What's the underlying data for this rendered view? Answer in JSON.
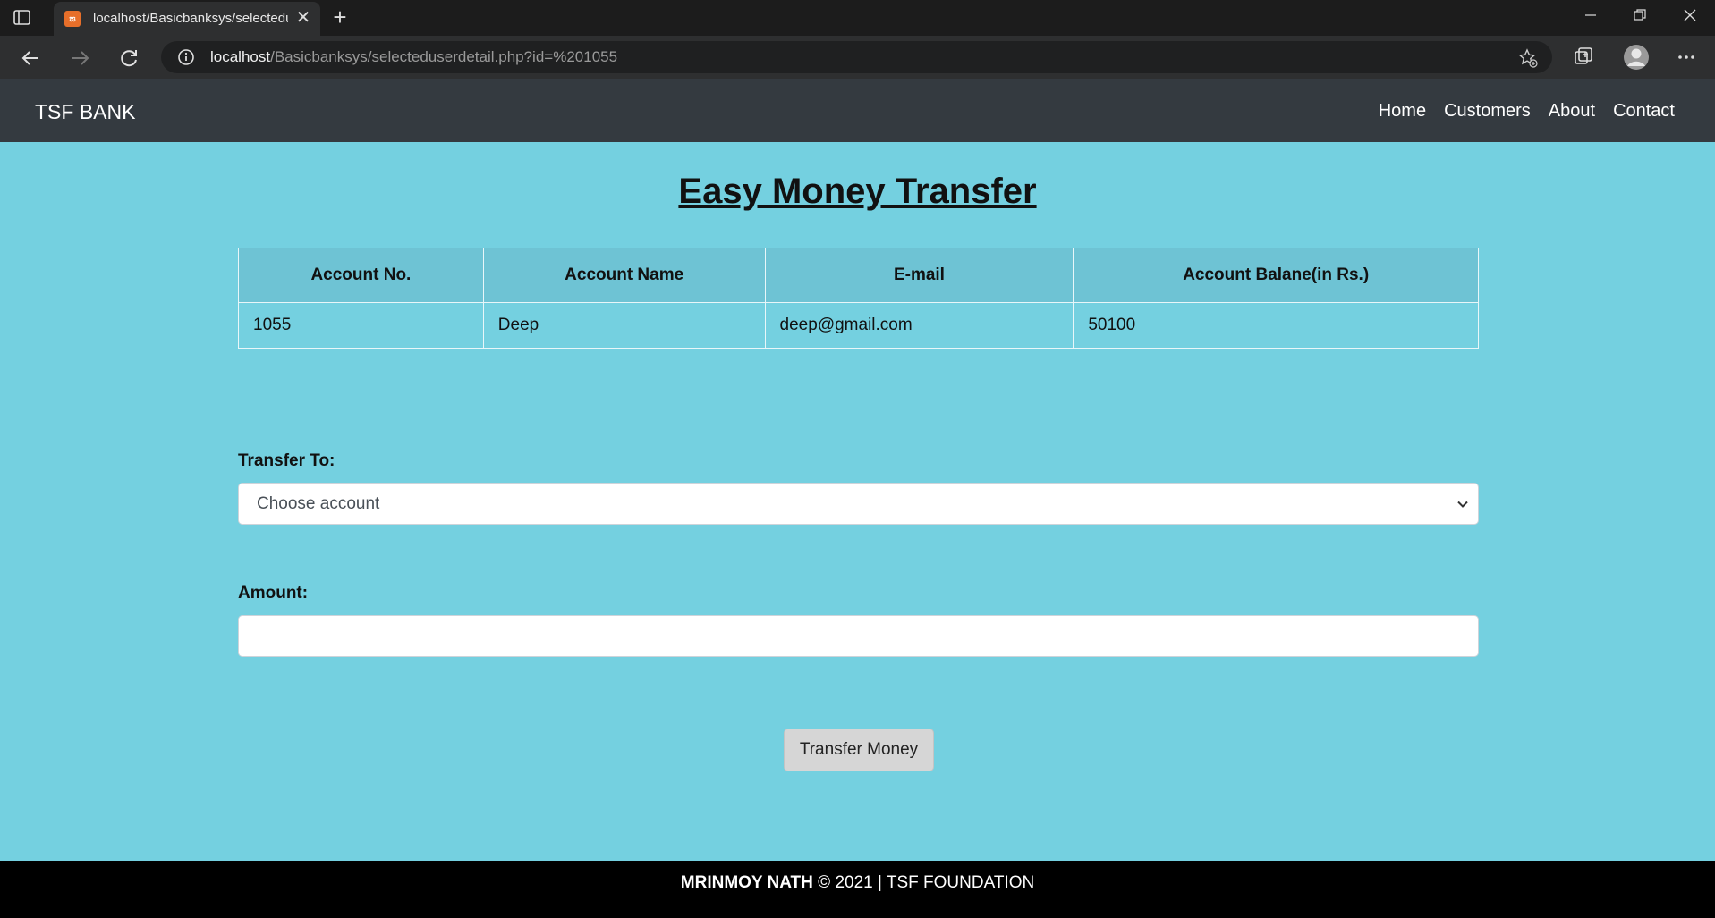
{
  "browser": {
    "tab_title": "localhost/Basicbanksys/selecteduserdetail.php?id=%201055",
    "url_host": "localhost",
    "url_path": "/Basicbanksys/selecteduserdetail.php?id=%201055",
    "new_tab_symbol": "+",
    "close_tab_symbol": "✕"
  },
  "navbar": {
    "brand": "TSF BANK",
    "links": [
      "Home",
      "Customers",
      "About",
      "Contact"
    ]
  },
  "main": {
    "title": "Easy Money Transfer",
    "table": {
      "headers": [
        "Account No.",
        "Account Name",
        "E-mail",
        "Account Balane(in Rs.)"
      ],
      "rows": [
        [
          "1055",
          "Deep",
          "deep@gmail.com",
          "50100"
        ]
      ]
    },
    "transfer_to_label": "Transfer To:",
    "transfer_to_value": "Choose account",
    "amount_label": "Amount:",
    "amount_value": "",
    "submit_label": "Transfer Money"
  },
  "footer": {
    "author": "MRINMOY NATH",
    "copyright": "© 2021",
    "separator": "|",
    "org": "TSF FOUNDATION"
  },
  "icons": [
    "sidebar-toggle-icon",
    "xampp-favicon-icon",
    "back-arrow-icon",
    "forward-arrow-icon",
    "reload-icon",
    "site-info-icon",
    "add-favorite-icon",
    "collections-icon",
    "profile-icon",
    "more-menu-icon",
    "chevron-down-icon"
  ]
}
